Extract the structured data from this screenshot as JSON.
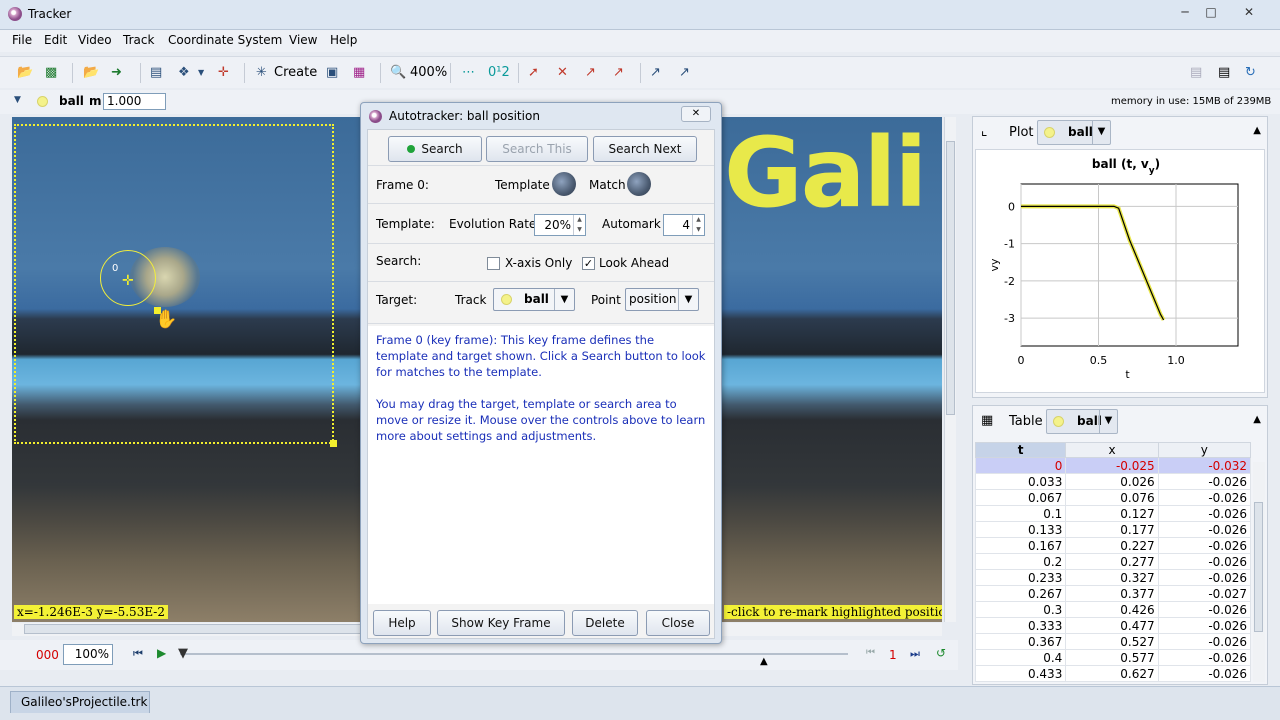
{
  "window": {
    "title": "Tracker",
    "min": "─",
    "max": "□",
    "close": "✕"
  },
  "menu": [
    "File",
    "Edit",
    "Video",
    "Track",
    "Coordinate System",
    "View",
    "Help"
  ],
  "toolbar": {
    "create_label": "Create",
    "zoom_label": "400%"
  },
  "trackbar": {
    "track_name": "ball",
    "mass_label": "m",
    "mass_value": "1.000",
    "memory": "memory in use: 15MB of 239MB"
  },
  "video": {
    "overlay_text": "Gali",
    "target_label": "0",
    "coords": "x=-1.246E-3  y=-5.53E-2",
    "hint": "-click to re-mark highlighted position)"
  },
  "player": {
    "frame": "000",
    "zoom": "100%",
    "step": "1"
  },
  "file_tab": "Galileo'sProjectile.trk",
  "plot_panel": {
    "label": "Plot",
    "track": "ball"
  },
  "chart_data": {
    "type": "line",
    "title": "ball (t, vy)",
    "xlabel": "t",
    "ylabel": "vy",
    "x_ticks": [
      "0",
      "0.5",
      "1.0"
    ],
    "y_ticks": [
      "0",
      "-1",
      "-2",
      "-3"
    ],
    "xlim": [
      0,
      1.4
    ],
    "ylim": [
      -3.75,
      0.6
    ],
    "grid": true,
    "series": [
      {
        "color": "#000000",
        "x": [
          0.0,
          0.1,
          0.2,
          0.3,
          0.4,
          0.5,
          0.6,
          0.63,
          0.7,
          0.8,
          0.9,
          0.92
        ],
        "y": [
          0.0,
          0.0,
          0.0,
          0.0,
          0.0,
          0.0,
          0.0,
          -0.05,
          -0.9,
          -1.9,
          -2.9,
          -3.05
        ]
      }
    ]
  },
  "table_panel": {
    "label": "Table",
    "track": "ball",
    "columns": [
      "t",
      "x",
      "y"
    ],
    "rows": [
      [
        "0",
        "-0.025",
        "-0.032"
      ],
      [
        "0.033",
        "0.026",
        "-0.026"
      ],
      [
        "0.067",
        "0.076",
        "-0.026"
      ],
      [
        "0.1",
        "0.127",
        "-0.026"
      ],
      [
        "0.133",
        "0.177",
        "-0.026"
      ],
      [
        "0.167",
        "0.227",
        "-0.026"
      ],
      [
        "0.2",
        "0.277",
        "-0.026"
      ],
      [
        "0.233",
        "0.327",
        "-0.026"
      ],
      [
        "0.267",
        "0.377",
        "-0.027"
      ],
      [
        "0.3",
        "0.426",
        "-0.026"
      ],
      [
        "0.333",
        "0.477",
        "-0.026"
      ],
      [
        "0.367",
        "0.527",
        "-0.026"
      ],
      [
        "0.4",
        "0.577",
        "-0.026"
      ],
      [
        "0.433",
        "0.627",
        "-0.026"
      ]
    ]
  },
  "dialog": {
    "title": "Autotracker: ball position",
    "close": "✕",
    "search": "Search",
    "search_this": "Search This",
    "search_next": "Search Next",
    "frame_label": "Frame 0:",
    "template_label": "Template",
    "match_label": "Match",
    "template_row_label": "Template:",
    "evolution_label": "Evolution Rate",
    "evolution_value": "20%",
    "automark_label": "Automark",
    "automark_value": "4",
    "search_row_label": "Search:",
    "xaxis_only": "X-axis Only",
    "look_ahead": "Look Ahead",
    "target_row_label": "Target:",
    "track_label": "Track",
    "track_value": "ball",
    "point_label": "Point",
    "point_value": "position",
    "info1": "Frame 0 (key frame): This key frame defines the template and target shown. Click a Search button to look for matches to the template.",
    "info2": "You may drag the target, template or search area to move or resize it.  Mouse over the controls above to learn more about settings and adjustments.",
    "help": "Help",
    "show_key_frame": "Show Key Frame",
    "delete": "Delete",
    "close_btn": "Close"
  }
}
